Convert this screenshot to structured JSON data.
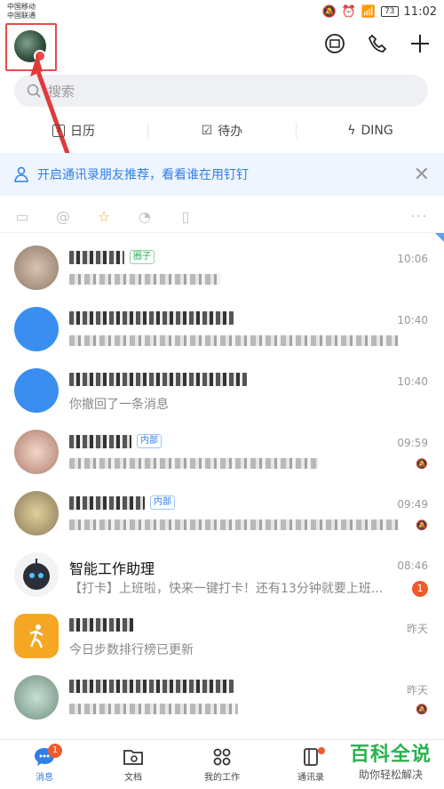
{
  "status_bar": {
    "carrier1": "中国移动",
    "carrier2": "中国联通",
    "battery": "73",
    "time": "11:02"
  },
  "search": {
    "placeholder": "搜索"
  },
  "quick": {
    "calendar": "日历",
    "calendar_num": "3",
    "todo": "待办",
    "ding": "DING"
  },
  "banner": {
    "text": "开启通讯录朋友推荐，看看谁在用钉钉"
  },
  "conversations": [
    {
      "time": "10:06",
      "tag": "圈子",
      "color": "#c9a98f"
    },
    {
      "time": "10:40",
      "color": "#3a8ef0"
    },
    {
      "time": "10:40",
      "color": "#3a8ef0",
      "preview": "你撤回了一条消息"
    },
    {
      "time": "09:59",
      "tag": "内部",
      "color": "#e8b9a8"
    },
    {
      "time": "09:49",
      "tag": "内部",
      "color": "#c9b88f"
    },
    {
      "name": "智能工作助理",
      "time": "08:46",
      "preview": "【打卡】上班啦，快来一键打卡！还有13分钟就要上班...",
      "unread": "1",
      "color": "#f3f3f3"
    },
    {
      "time": "昨天",
      "preview": "今日步数排行榜已更新",
      "color": "#f5a623"
    },
    {
      "time": "昨天",
      "color": "#9dc4b0"
    }
  ],
  "nav": {
    "messages": "消息",
    "messages_badge": "1",
    "docs": "文档",
    "work": "我的工作",
    "contacts": "通讯录"
  },
  "watermark": {
    "big": "百科全说",
    "small": "助你轻松解决"
  }
}
